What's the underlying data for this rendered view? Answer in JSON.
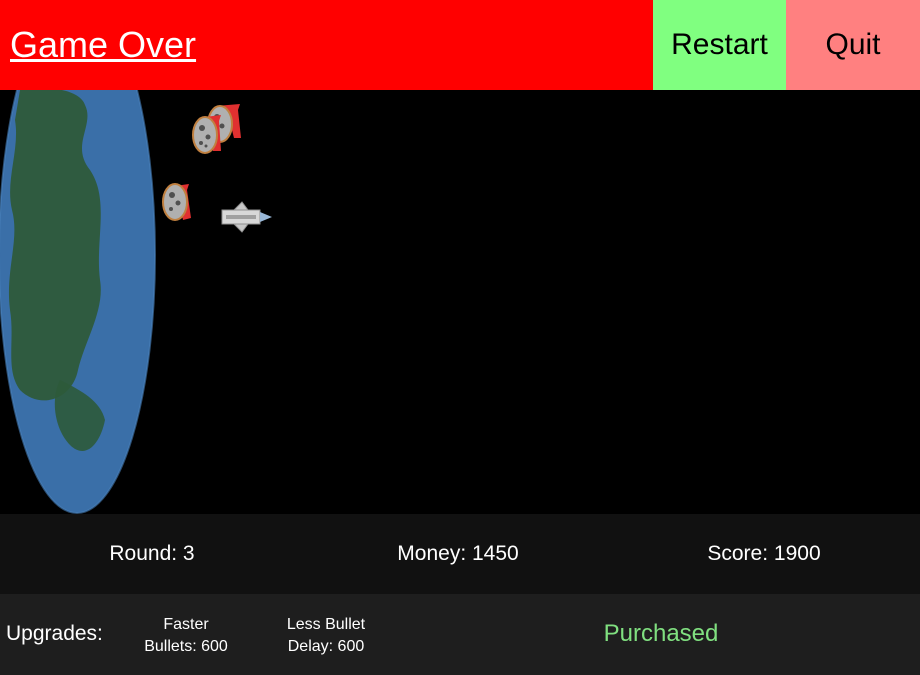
{
  "header": {
    "title": "Game Over",
    "restart_label": "Restart",
    "quit_label": "Quit"
  },
  "stats": {
    "round": "Round: 3",
    "money": "Money: 1450",
    "score": "Score: 1900"
  },
  "upgrades": {
    "label": "Upgrades:",
    "items": [
      {
        "line1": "Faster",
        "line2": "Bullets: 600"
      },
      {
        "line1": "Less Bullet",
        "line2": "Delay: 600"
      }
    ],
    "status": "Purchased"
  },
  "colors": {
    "title_bar": "#ff0000",
    "restart": "#80ff80",
    "quit": "#ff8080",
    "purchased": "#80e080",
    "planet_ocean": "#3a6fa8",
    "planet_land": "#2e5a3a"
  },
  "sprites": {
    "planet": "planet-earth",
    "asteroids": [
      "asteroid",
      "asteroid",
      "asteroid"
    ],
    "player": "player-spaceship"
  }
}
